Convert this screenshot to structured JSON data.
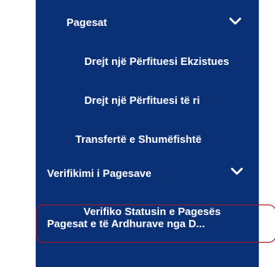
{
  "menu": {
    "pagesat": {
      "label": "Pagesat",
      "icon": "chevron-down-icon",
      "items": [
        {
          "label": "Drejt një Përfituesi Ekzistues"
        },
        {
          "label": "Drejt një Përfituesi të ri"
        },
        {
          "label": "Transfertë e Shumëfishtë"
        }
      ]
    },
    "verifikimi": {
      "label": "Verifikimi i Pagesave",
      "icon": "chevron-down-icon",
      "items": [
        {
          "label": "Verifiko Statusin e Pagesës"
        }
      ]
    },
    "highlighted_item": {
      "label": "Pagesat e të Ardhurave nga D..."
    }
  },
  "colors": {
    "sidebar_bg": "#0a3075",
    "text": "#ffffff",
    "highlight_border": "#a0192a"
  }
}
